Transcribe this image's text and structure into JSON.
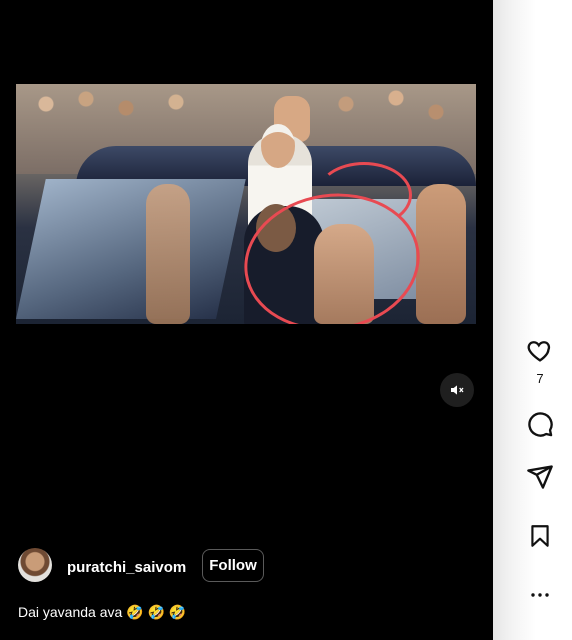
{
  "post": {
    "username": "puratchi_saivom",
    "follow_label": "Follow",
    "caption": "Dai yavanda ava 🤣 🤣 🤣"
  },
  "actions": {
    "like_count": "7",
    "icons": [
      "heart-icon",
      "comment-icon",
      "share-icon",
      "bookmark-icon",
      "more-icon"
    ]
  },
  "media": {
    "mute_icon": "speaker-muted-icon",
    "highlight_color": "#e84a52"
  },
  "colors": {
    "background": "#000000",
    "sidebar": "#f4f4f4",
    "text": "#ffffff"
  }
}
